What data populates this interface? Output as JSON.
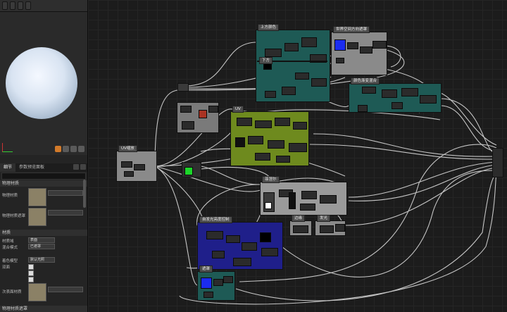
{
  "toolbar": {
    "buttons": [
      "",
      "",
      "",
      ""
    ]
  },
  "details": {
    "tabs": [
      "细节",
      "参数预览面板"
    ],
    "sections": {
      "physics": "物理材质",
      "material": "材质",
      "advanced": "物理材质遮罩"
    },
    "properties": {
      "phys_mat_label": "物理材质",
      "phys_mask_label": "物理材质遮罩",
      "blend_label": "材质域",
      "blend_value": "表面",
      "mode_label": "混合模式",
      "mode_value": "已遮罩",
      "shading_label": "着色模型",
      "shading_value": "默认光照",
      "twosided_label": "双面",
      "adv_label": "次表面材质",
      "footer": "物理材质遮罩"
    }
  },
  "graph": {
    "comments": [
      "上方颜色",
      "世界空间方向遮罩",
      "下方",
      "颜色渐变混合",
      "UV缩放",
      "UV",
      "菲涅尔",
      "边缘",
      "发光",
      "自发光亮度控制",
      "遮罩"
    ]
  },
  "colors": {
    "teal": "#1e5a55",
    "olive": "#6e8a1e",
    "blue": "#1f1f8a",
    "gray_node": "#7a7a7a",
    "wire": "#d8d8d8",
    "accent": "#d27a2a"
  }
}
